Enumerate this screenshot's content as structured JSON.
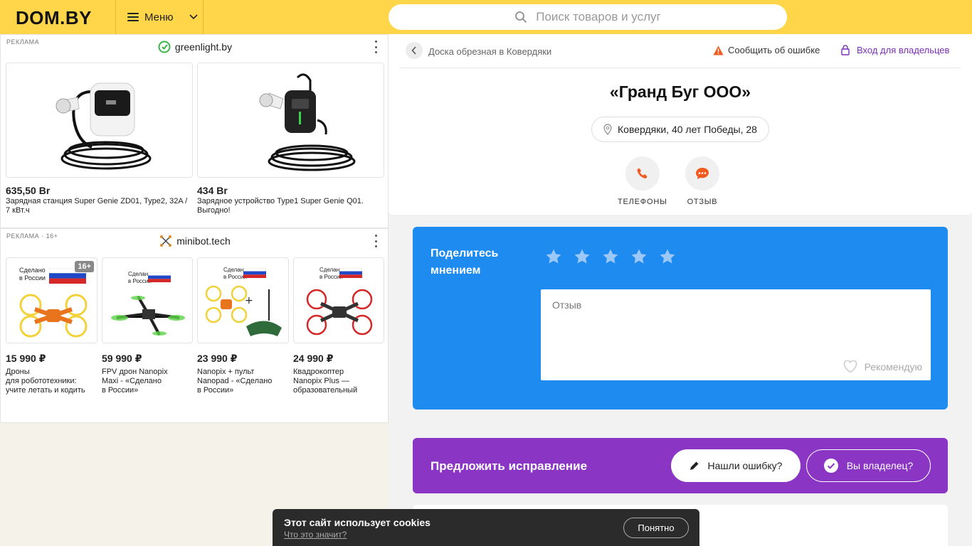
{
  "header": {
    "logo": "DOM.BY",
    "menu_label": "Меню",
    "search_placeholder": "Поиск товаров и услуг",
    "brand_color": "#ffd54a"
  },
  "ads": [
    {
      "label": "РЕКЛАМА",
      "brand": "greenlight.by",
      "brand_icon": "leaf-plug-icon",
      "products": [
        {
          "price": "635,50 Br",
          "desc": "Зарядная станция Super Genie ZD01, Type2, 32A / 7 кВт.ч",
          "image": "ev-charger-wallbox-image"
        },
        {
          "price": "434 Br",
          "desc": "Зарядное устройство Type1 Super Genie Q01. Выгодно!",
          "image": "ev-charger-portable-image"
        }
      ]
    },
    {
      "label": "РЕКЛАМА · 16+",
      "brand": "minibot.tech",
      "brand_icon": "drone-logo-icon",
      "products": [
        {
          "price": "15 990 ₽",
          "desc": "Дроны\nдля робототехники:\nучите летать и кодить",
          "flag_text": "Сделано\nв России",
          "badge": "16+"
        },
        {
          "price": "59 990 ₽",
          "desc": "FPV дрон Nanopix\nMaxi - «Сделано\nв России»",
          "flag_text": "Сделано\nв России"
        },
        {
          "price": "23 990 ₽",
          "desc": "Nanopix + пульт\nNanopad - «Сделано\nв России»",
          "flag_text": "Сделано\nв России"
        },
        {
          "price": "24 990 ₽",
          "desc": "Квадрокоптер\nNanopix Plus —\nобразовательный",
          "flag_text": "Сделано\nв России"
        }
      ]
    }
  ],
  "card": {
    "breadcrumb": "Доска обрезная в Ковердяки",
    "report_label": "Сообщить об ошибке",
    "owner_login_label": "Вход для владельцев",
    "company_name": "«Гранд Буг ООО»",
    "address": "Ковердяки, 40 лет Победы, 28",
    "actions": [
      {
        "label": "ТЕЛЕФОНЫ",
        "icon": "phone-icon"
      },
      {
        "label": "ОТЗЫВ",
        "icon": "chat-icon"
      }
    ]
  },
  "review": {
    "title": "Поделитесь мнением",
    "stars_count": 5,
    "placeholder": "Отзыв",
    "recommend_label": "Рекомендую",
    "bg_color": "#1e8bf0"
  },
  "suggest": {
    "title": "Предложить исправление",
    "error_button": "Нашли ошибку?",
    "owner_button": "Вы владелец?",
    "bg_color": "#8a35c4"
  },
  "cookie": {
    "title": "Этот сайт использует cookies",
    "link": "Что это значит?",
    "button": "Понятно"
  }
}
